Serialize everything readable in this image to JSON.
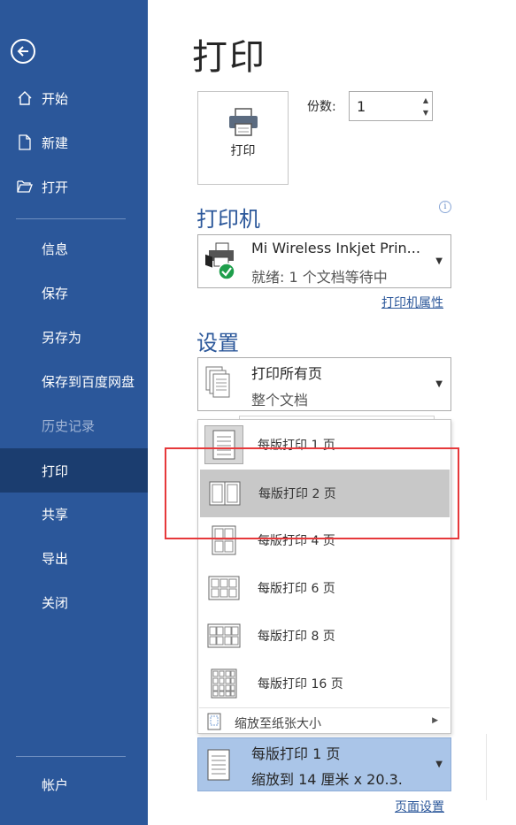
{
  "sidebar": {
    "back_label": "",
    "items": [
      {
        "label": "开始",
        "icon": "home-icon"
      },
      {
        "label": "新建",
        "icon": "new-document-icon"
      },
      {
        "label": "打开",
        "icon": "folder-open-icon"
      },
      {
        "label": "信息"
      },
      {
        "label": "保存"
      },
      {
        "label": "另存为"
      },
      {
        "label": "保存到百度网盘"
      },
      {
        "label": "历史记录",
        "disabled": true
      },
      {
        "label": "打印",
        "active": true
      },
      {
        "label": "共享"
      },
      {
        "label": "导出"
      },
      {
        "label": "关闭"
      },
      {
        "label": "帐户"
      }
    ]
  },
  "main": {
    "title": "打印",
    "print_button_label": "打印",
    "copies_label": "份数:",
    "copies_value": "1",
    "printer_section_title": "打印机",
    "printer": {
      "name": "Mi Wireless Inkjet Prin...",
      "status": "就绪: 1 个文档等待中"
    },
    "printer_properties_link": "打印机属性",
    "settings_section_title": "设置",
    "pages_dropdown": {
      "title": "打印所有页",
      "sub": "整个文档"
    },
    "pages_per_sheet_options": [
      {
        "label": "每版打印 1 页",
        "selected": true
      },
      {
        "label": "每版打印 2 页",
        "hovered": true
      },
      {
        "label": "每版打印 4 页"
      },
      {
        "label": "每版打印 6 页"
      },
      {
        "label": "每版打印 8 页"
      },
      {
        "label": "每版打印 16 页"
      }
    ],
    "scale_to_paper_label": "缩放至纸张大小",
    "pages_per_sheet_dropdown": {
      "title": "每版打印 1 页",
      "sub": "缩放到 14 厘米 x 20.3..."
    },
    "page_setup_link": "页面设置"
  },
  "colors": {
    "sidebar_bg": "#2b579a",
    "sidebar_active": "#1b3d6f",
    "accent": "#2b579a",
    "highlight_border": "#e6393b",
    "hover_item": "#c8c8c8",
    "selected_dropdown": "#aac5e8"
  }
}
